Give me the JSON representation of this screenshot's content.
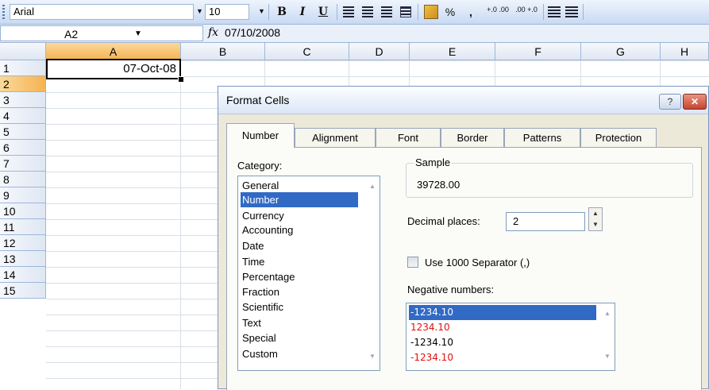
{
  "toolbar": {
    "font_name": "Arial",
    "font_size": "10",
    "bold": "B",
    "italic": "I",
    "underline": "U",
    "percent": "%",
    "comma": ",",
    "increase_decimal": "+.0 .00",
    "decrease_decimal": ".00 +.0"
  },
  "formula_bar": {
    "name_box": "A2",
    "fx": "fx",
    "formula": "07/10/2008"
  },
  "grid": {
    "columns": [
      "A",
      "B",
      "C",
      "D",
      "E",
      "F",
      "G",
      "H"
    ],
    "rows": [
      "1",
      "2",
      "3",
      "4",
      "5",
      "6",
      "7",
      "8",
      "9",
      "10",
      "11",
      "12",
      "13",
      "14",
      "15"
    ],
    "active_cell_value": "07-Oct-08"
  },
  "dialog": {
    "title": "Format Cells",
    "help": "?",
    "close": "✕",
    "tabs": [
      "Number",
      "Alignment",
      "Font",
      "Border",
      "Patterns",
      "Protection"
    ],
    "category_label": "Category:",
    "categories": [
      "General",
      "Number",
      "Currency",
      "Accounting",
      "Date",
      "Time",
      "Percentage",
      "Fraction",
      "Scientific",
      "Text",
      "Special",
      "Custom"
    ],
    "selected_category": "Number",
    "sample_label": "Sample",
    "sample_value": "39728.00",
    "decimal_label": "Decimal places:",
    "decimal_value": "2",
    "separator_label": "Use 1000 Separator (,)",
    "negative_label": "Negative numbers:",
    "negative_options": [
      "-1234.10",
      "1234.10",
      "-1234.10",
      "-1234.10"
    ],
    "negative_colors": [
      "#ffffff",
      "#e01010",
      "#000000",
      "#e01010"
    ]
  }
}
